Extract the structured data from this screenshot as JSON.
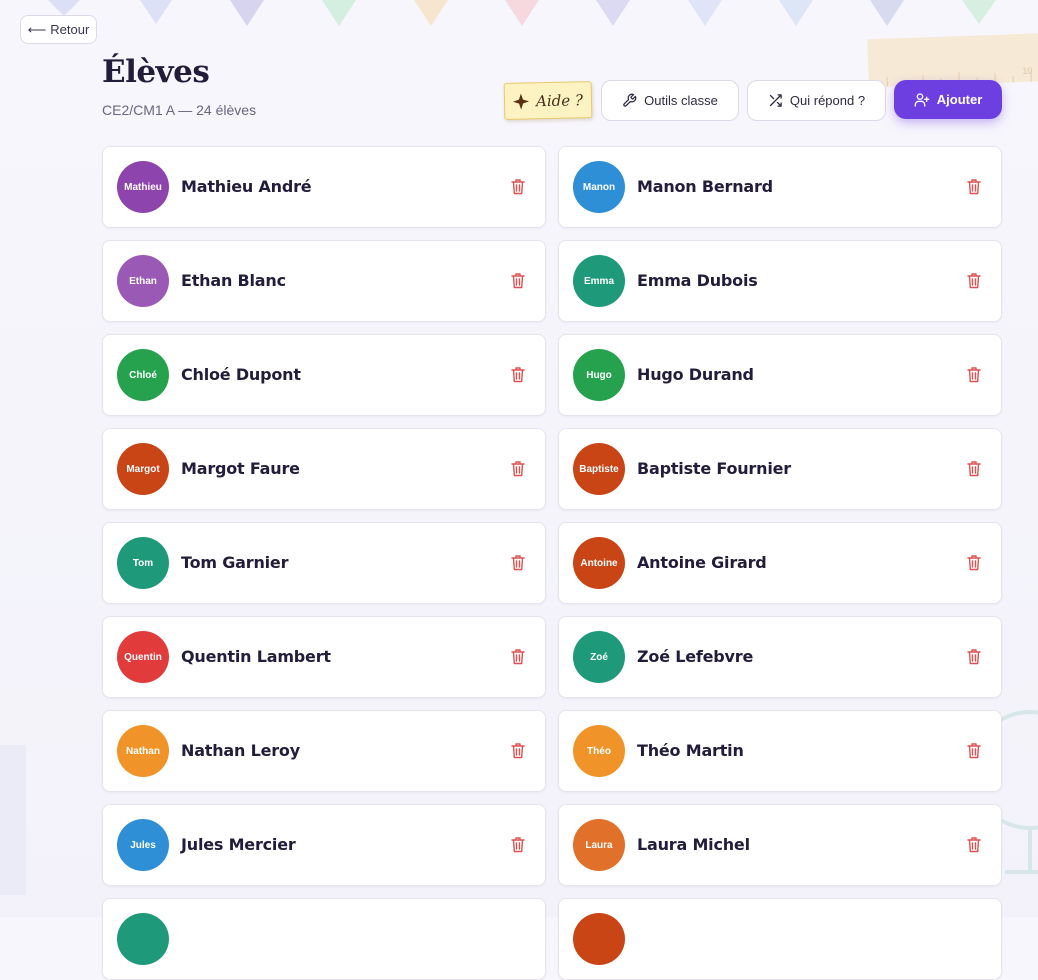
{
  "nav": {
    "back_label": "Retour"
  },
  "header": {
    "title": "Élèves",
    "subtitle": "CE2/CM1 A — 24 élèves"
  },
  "toolbar": {
    "help_label": "Aide ?",
    "tools_label": "Outils classe",
    "random_label": "Qui répond ?",
    "add_label": "Ajouter"
  },
  "colors": {
    "accent": "#6d3fe0",
    "trash": "#e05050",
    "purple": "#8e44ad",
    "blue": "#2e8fd6",
    "violet": "#9b59b6",
    "teal": "#1e9a7a",
    "green": "#26a24f",
    "rust": "#c94516",
    "red": "#e23b3b",
    "orange": "#f0942a",
    "burnt": "#e0702a"
  },
  "decor": {
    "ruler_number": "10"
  },
  "students": [
    {
      "short": "Mathieu",
      "name": "Mathieu André",
      "color": "#8e44ad"
    },
    {
      "short": "Manon",
      "name": "Manon Bernard",
      "color": "#2e8fd6"
    },
    {
      "short": "Ethan",
      "name": "Ethan Blanc",
      "color": "#9b59b6"
    },
    {
      "short": "Emma",
      "name": "Emma Dubois",
      "color": "#1e9a7a"
    },
    {
      "short": "Chloé",
      "name": "Chloé Dupont",
      "color": "#26a24f"
    },
    {
      "short": "Hugo",
      "name": "Hugo Durand",
      "color": "#26a24f"
    },
    {
      "short": "Margot",
      "name": "Margot Faure",
      "color": "#c94516"
    },
    {
      "short": "Baptiste",
      "name": "Baptiste Fournier",
      "color": "#c94516"
    },
    {
      "short": "Tom",
      "name": "Tom Garnier",
      "color": "#1e9a7a"
    },
    {
      "short": "Antoine",
      "name": "Antoine Girard",
      "color": "#c94516"
    },
    {
      "short": "Quentin",
      "name": "Quentin Lambert",
      "color": "#e23b3b"
    },
    {
      "short": "Zoé",
      "name": "Zoé Lefebvre",
      "color": "#1e9a7a"
    },
    {
      "short": "Nathan",
      "name": "Nathan Leroy",
      "color": "#f0942a"
    },
    {
      "short": "Théo",
      "name": "Théo Martin",
      "color": "#f0942a"
    },
    {
      "short": "Jules",
      "name": "Jules Mercier",
      "color": "#2e8fd6"
    },
    {
      "short": "Laura",
      "name": "Laura Michel",
      "color": "#e0702a"
    }
  ]
}
